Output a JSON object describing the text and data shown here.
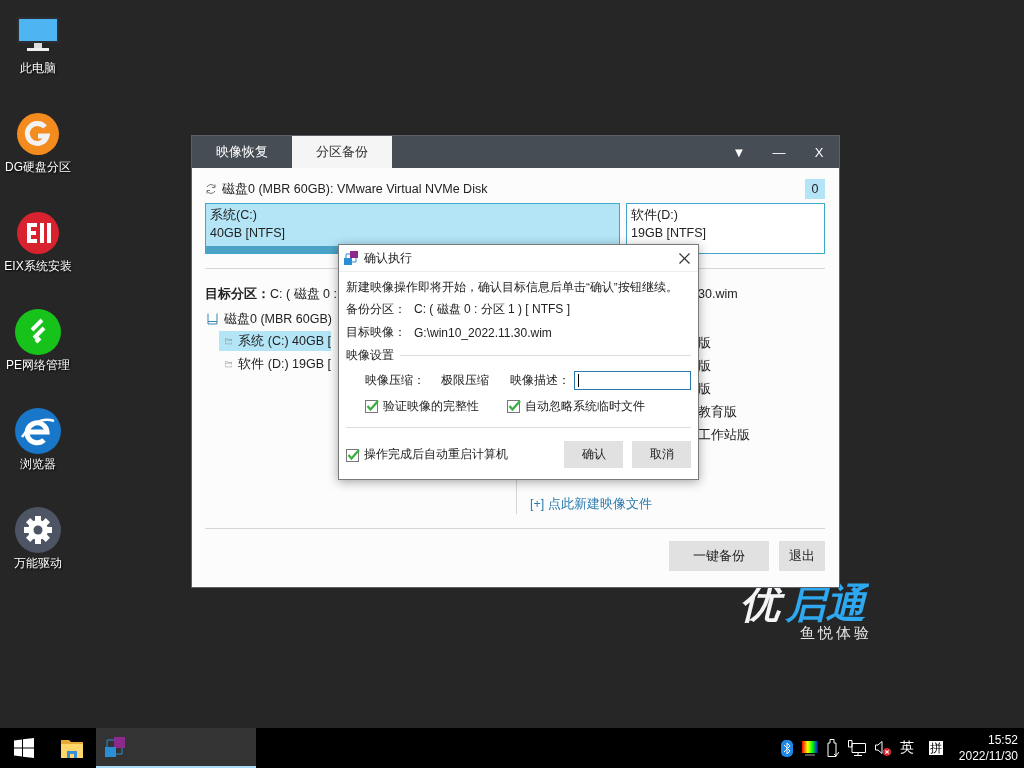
{
  "desktop_icons": [
    {
      "label": "此电脑",
      "kind": "computer"
    },
    {
      "label": "DG硬盘分区",
      "kind": "partition"
    },
    {
      "label": "EIX系统安装",
      "kind": "installer"
    },
    {
      "label": "PE网络管理",
      "kind": "network"
    },
    {
      "label": "浏览器",
      "kind": "browser"
    },
    {
      "label": "万能驱动",
      "kind": "driver"
    }
  ],
  "window": {
    "tabs": [
      {
        "label": "映像恢复",
        "selected": false
      },
      {
        "label": "分区备份",
        "selected": true
      }
    ],
    "controls": [
      "▼",
      "—",
      "X"
    ],
    "disk": {
      "title": "磁盘0 (MBR 60GB): VMware Virtual NVMe Disk",
      "badge": "0",
      "partitions": [
        {
          "name": "系统(C:)",
          "size": "40GB [NTFS]",
          "selected": true
        },
        {
          "name": "软件(D:)",
          "size": "19GB [NTFS]",
          "selected": false
        }
      ]
    },
    "target": {
      "label": "目标分区：",
      "value": "C: ( 磁盘 0 :"
    },
    "tree": {
      "label": "磁盘0 (MBR 60GB)",
      "children": [
        {
          "label": "系统 (C:) 40GB [",
          "selected": true
        },
        {
          "label": "软件 (D:) 19GB [",
          "selected": false
        }
      ]
    },
    "images": {
      "path": "30.wim",
      "items": [
        "版",
        "版",
        "版",
        "教育版",
        "工作站版"
      ],
      "new_link": "[+] 点此新建映像文件"
    },
    "buttons": [
      "一键备份",
      "退出"
    ]
  },
  "dialog": {
    "title": "确认执行",
    "message": "新建映像操作即将开始，确认目标信息后单击“确认”按钮继续。",
    "fields": [
      {
        "label": "备份分区：",
        "value": "C: ( 磁盘 0 : 分区 1 ) [ NTFS ]"
      },
      {
        "label": "目标映像：",
        "value": "G:\\win10_2022.11.30.wim"
      }
    ],
    "section": "映像设置",
    "compression_label": "映像压缩：",
    "compression": "极限压缩",
    "description_label": "映像描述：",
    "options": [
      {
        "label": "验证映像的完整性",
        "checked": true
      },
      {
        "label": "自动忽略系统临时文件",
        "checked": true
      }
    ],
    "restart": {
      "label": "操作完成后自动重启计算机",
      "checked": true
    },
    "buttons": [
      "确认",
      "取消"
    ]
  },
  "logo": {
    "first": "优",
    "rest": "启通",
    "slogan": "鱼悦体验"
  },
  "taskbar": {
    "ime_lang": "英",
    "ime_mode": "拼",
    "time": "15:52",
    "date": "2022/11/30"
  }
}
